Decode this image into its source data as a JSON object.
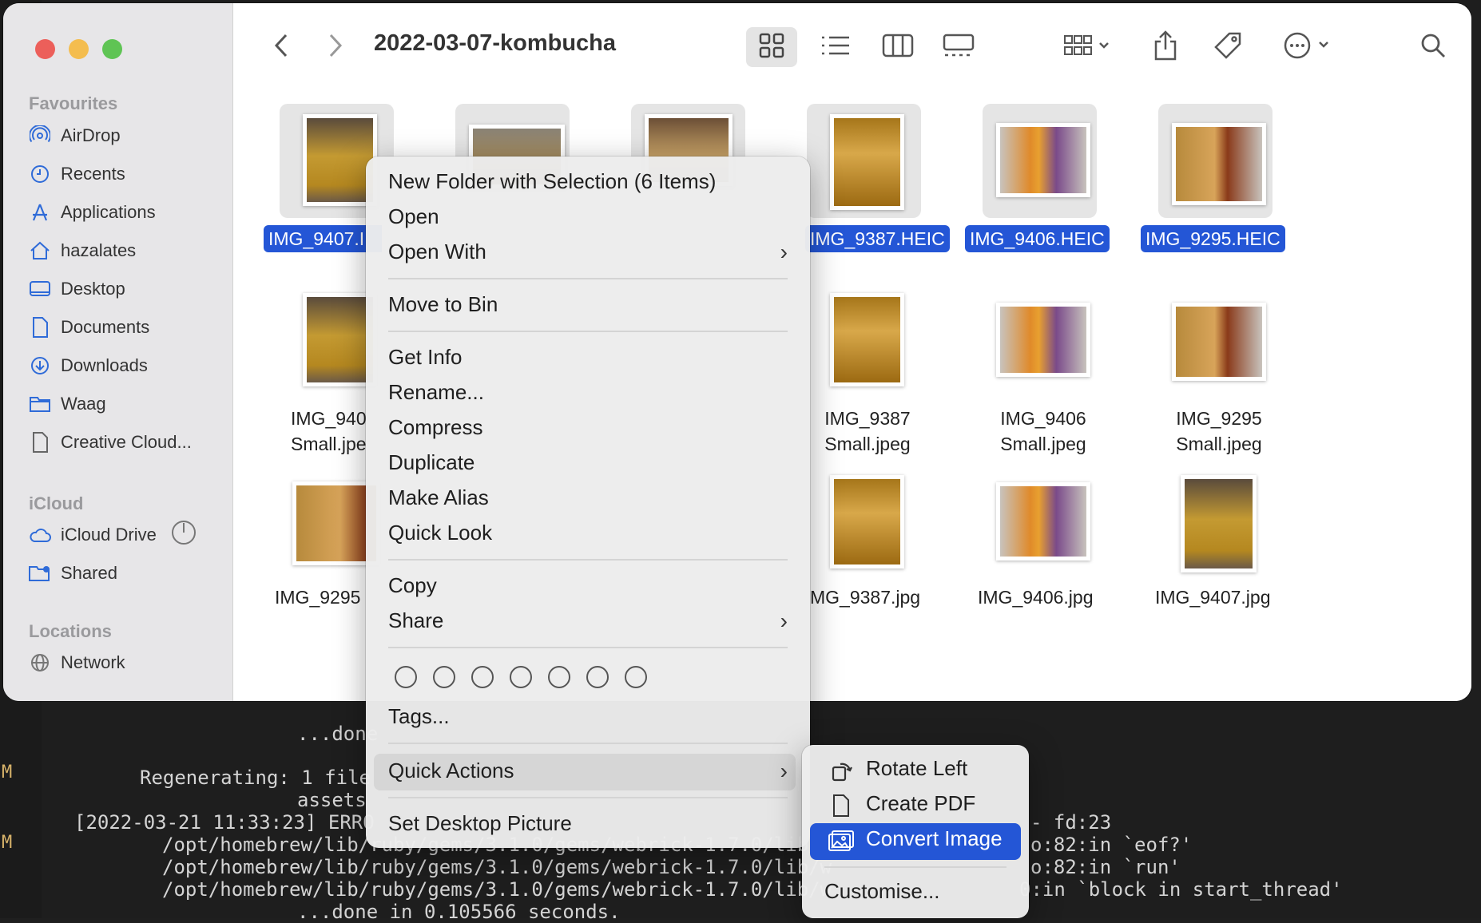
{
  "window": {
    "title": "2022-03-07-kombucha"
  },
  "sidebar": {
    "favourites_header": "Favourites",
    "icloud_header": "iCloud",
    "locations_header": "Locations",
    "items": [
      {
        "label": "AirDrop",
        "icon": "airdrop-icon"
      },
      {
        "label": "Recents",
        "icon": "clock-icon"
      },
      {
        "label": "Applications",
        "icon": "applications-icon"
      },
      {
        "label": "hazalates",
        "icon": "home-icon"
      },
      {
        "label": "Desktop",
        "icon": "desktop-icon"
      },
      {
        "label": "Documents",
        "icon": "document-icon"
      },
      {
        "label": "Downloads",
        "icon": "download-icon"
      },
      {
        "label": "Waag",
        "icon": "folder-icon"
      },
      {
        "label": "Creative Cloud...",
        "icon": "file-icon"
      },
      {
        "label": "iCloud Drive",
        "icon": "cloud-icon"
      },
      {
        "label": "Shared",
        "icon": "shared-folder-icon"
      },
      {
        "label": "Network",
        "icon": "globe-icon"
      }
    ]
  },
  "files": {
    "row1": [
      "IMG_9407.I",
      "IMG_9387.HEIC",
      "IMG_9406.HEIC",
      "IMG_9295.HEIC"
    ],
    "row2": [
      {
        "l1": "IMG_940",
        "l2": "Small.jpe"
      },
      {
        "l1": "IMG_9387",
        "l2": "Small.jpeg"
      },
      {
        "l1": "IMG_9406",
        "l2": "Small.jpeg"
      },
      {
        "l1": "IMG_9295",
        "l2": "Small.jpeg"
      }
    ],
    "row3": [
      "IMG_9295",
      "MG_9387.jpg",
      "IMG_9406.jpg",
      "IMG_9407.jpg"
    ]
  },
  "context_menu": {
    "new_folder": "New Folder with Selection (6 Items)",
    "open": "Open",
    "open_with": "Open With",
    "move_to_bin": "Move to Bin",
    "get_info": "Get Info",
    "rename": "Rename...",
    "compress": "Compress",
    "duplicate": "Duplicate",
    "make_alias": "Make Alias",
    "quick_look": "Quick Look",
    "copy": "Copy",
    "share": "Share",
    "tags": "Tags...",
    "quick_actions": "Quick Actions",
    "set_desktop": "Set Desktop Picture"
  },
  "submenu": {
    "rotate_left": "Rotate Left",
    "create_pdf": "Create PDF",
    "convert_image": "Convert Image",
    "customise": "Customise..."
  },
  "terminal": {
    "lines": [
      "...done",
      "Regenerating: 1 file",
      "assets",
      "[2022-03-21 11:33:23] ERRO",
      "/opt/homebrew/lib/ruby/gems/3.1.0/gems/webrick-1.7.0/lib/",
      "/opt/homebrew/lib/ruby/gems/3.1.0/gems/webrick-1.7.0/lib/w",
      "/opt/homebrew/lib/ruby/gems/3.1.0/gems/webrick-1.7.0/lib/w",
      "...done in 0.105566 seconds."
    ],
    "right_lines": [
      "- fd:23",
      "o:82:in `eof?'",
      "o:82:in `run'",
      "0:in `block in start_thread'"
    ],
    "gutter_mark": "M"
  },
  "colors": {
    "selection": "#2456d6",
    "accent_close": "#ec5f5a",
    "accent_min": "#f4bd4f",
    "accent_max": "#5fc454"
  }
}
